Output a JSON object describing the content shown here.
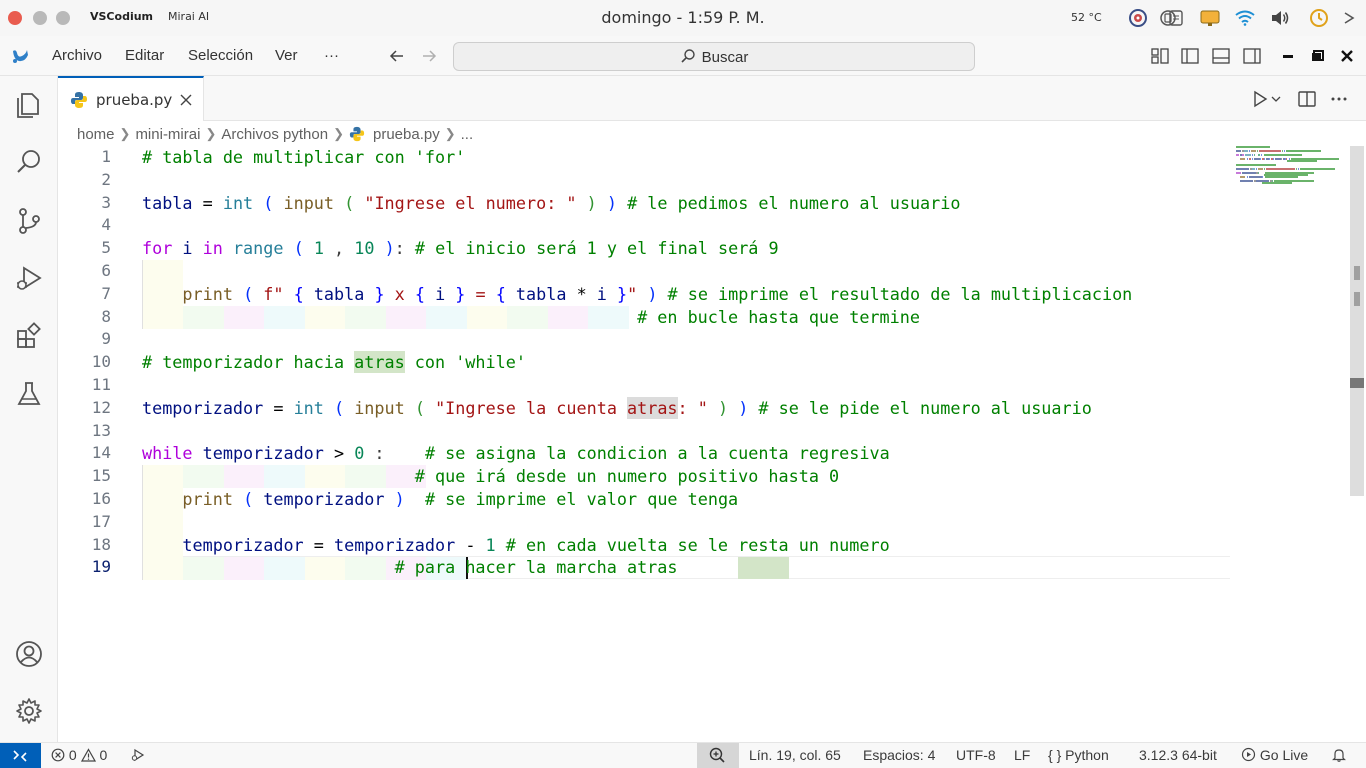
{
  "os": {
    "app_name": "VSCodium",
    "app_secondary": "Mirai AI",
    "clock": "domingo - 1:59 P. M.",
    "temperature": "52 °C"
  },
  "menu": {
    "items": [
      "Archivo",
      "Editar",
      "Selección",
      "Ver"
    ],
    "more": "···",
    "search_placeholder": "Buscar"
  },
  "tab": {
    "label": "prueba.py",
    "close_glyph": "✕"
  },
  "breadcrumb": [
    "home",
    "mini-mirai",
    "Archivos python",
    "prueba.py",
    "..."
  ],
  "editor": {
    "active_line": 19,
    "line_numbers": [
      "1",
      "2",
      "3",
      "4",
      "5",
      "6",
      "7",
      "8",
      "9",
      "10",
      "11",
      "12",
      "13",
      "14",
      "15",
      "16",
      "17",
      "18",
      "19"
    ]
  },
  "status": {
    "errors": "0",
    "warnings": "0",
    "position": "Lín. 19, col. 65",
    "spaces": "Espacios: 4",
    "encoding": "UTF-8",
    "eol": "LF",
    "language_glyph": "{ }",
    "language": "Python",
    "interpreter": "3.12.3 64-bit",
    "golive": "Go Live"
  },
  "colors": {
    "accent": "#005fb8",
    "comment": "#008000",
    "keyword": "#af00db",
    "string": "#a31515",
    "number": "#098658",
    "variable": "#001080",
    "builtin": "#267f99",
    "function": "#795e26"
  }
}
